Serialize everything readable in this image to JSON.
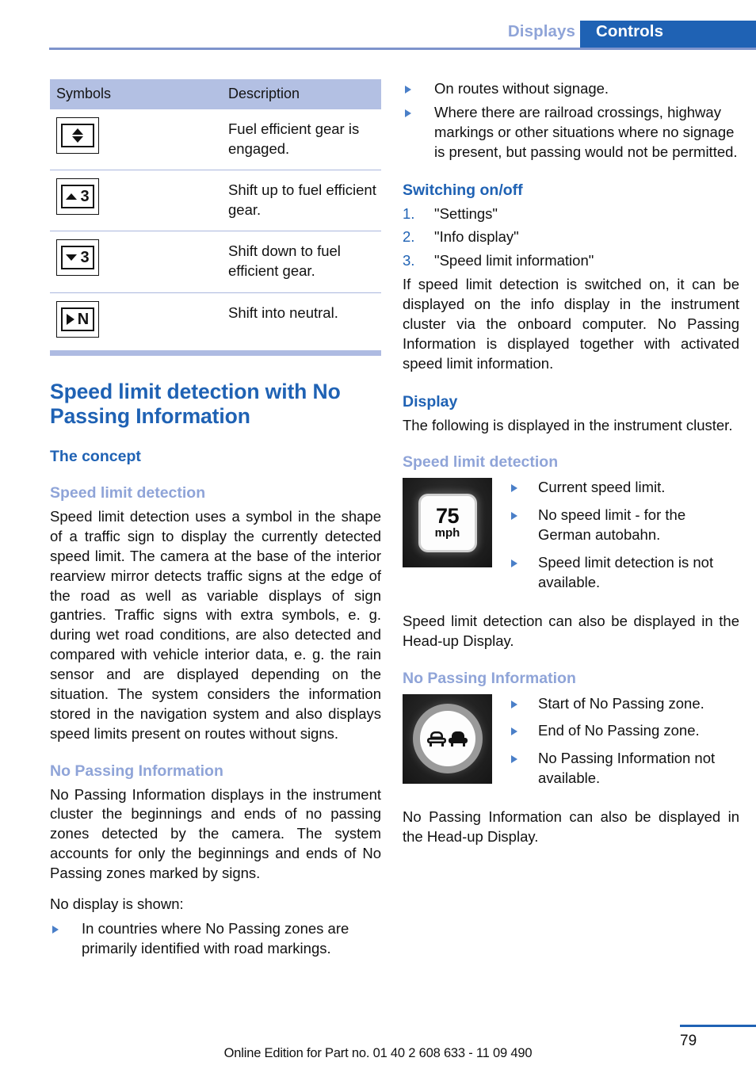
{
  "header": {
    "tab_displays": "Displays",
    "tab_controls": "Controls",
    "accent_blue": "#1f62b4",
    "accent_light_blue": "#8fa4d8"
  },
  "symbols_table": {
    "headers": {
      "symbols": "Symbols",
      "description": "Description"
    },
    "rows": [
      {
        "icon": "fuel-efficient-gear-engaged-icon",
        "description": "Fuel efficient gear is engaged."
      },
      {
        "icon": "shift-up-gear-3-icon",
        "gear": "3",
        "description": "Shift up to fuel efficient gear."
      },
      {
        "icon": "shift-down-gear-3-icon",
        "gear": "3",
        "description": "Shift down to fuel efficient gear."
      },
      {
        "icon": "shift-into-neutral-icon",
        "gear": "N",
        "description": "Shift into neutral."
      }
    ]
  },
  "left_column": {
    "section_title": "Speed limit detection with No Passing Information",
    "concept_heading": "The concept",
    "speed_limit_detection_heading": "Speed limit detection",
    "speed_limit_detection_body": "Speed limit detection uses a symbol in the shape of a traffic sign to display the currently detected speed limit. The camera at the base of the interior rearview mirror detects traffic signs at the edge of the road as well as variable displays of sign gantries. Traffic signs with extra symbols, e. g. during wet road conditions, are also detected and compared with vehicle interior data, e. g. the rain sensor and are displayed depending on the situation. The system considers the information stored in the navigation system and also displays speed limits present on routes without signs.",
    "no_passing_heading": "No Passing Information",
    "no_passing_body": "No Passing Information displays in the instrument cluster the beginnings and ends of no passing zones detected by the camera. The system accounts for only the beginnings and ends of No Passing zones marked by signs.",
    "no_display_intro": "No display is shown:",
    "no_display_bullets": [
      "In countries where No Passing zones are primarily identified with road markings."
    ]
  },
  "right_column": {
    "continued_bullets": [
      "On routes without signage.",
      "Where there are railroad crossings, highway markings or other situations where no signage is present, but passing would not be permitted."
    ],
    "switching_heading": "Switching on/off",
    "switching_steps": [
      {
        "num": "1.",
        "label": "\"Settings\""
      },
      {
        "num": "2.",
        "label": "\"Info display\""
      },
      {
        "num": "3.",
        "label": "\"Speed limit information\""
      }
    ],
    "switching_body": "If speed limit detection is switched on, it can be displayed on the info display in the instrument cluster via the onboard computer. No Passing Information is displayed together with activated speed limit information.",
    "display_heading": "Display",
    "display_body": "The following is displayed in the instrument cluster.",
    "speed_limit_heading": "Speed limit detection",
    "speed_limit_sign": {
      "icon": "speed-limit-sign-icon",
      "value": "75",
      "unit": "mph"
    },
    "speed_limit_bullets": [
      "Current speed limit.",
      "No speed limit - for the German autobahn.",
      "Speed limit detection is not available."
    ],
    "speed_limit_note": "Speed limit detection can also be displayed in the Head-up Display.",
    "no_passing_heading": "No Passing Information",
    "no_passing_sign": {
      "icon": "no-passing-sign-icon"
    },
    "no_passing_bullets": [
      "Start of No Passing zone.",
      "End of No Passing zone.",
      "No Passing Information not available."
    ],
    "no_passing_note": "No Passing Information can also be displayed in the Head-up Display."
  },
  "footer": {
    "page_number": "79",
    "note": "Online Edition for Part no. 01 40 2 608 633 - 11 09 490"
  }
}
